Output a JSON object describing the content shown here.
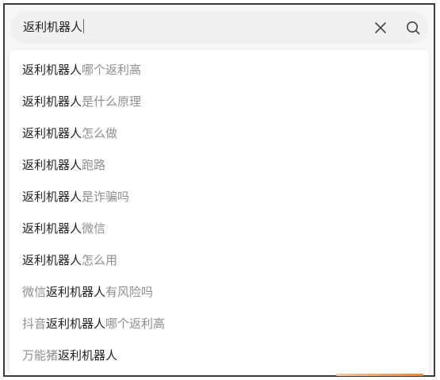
{
  "search": {
    "query": "返利机器人"
  },
  "icons": {
    "clear": "close-icon",
    "search": "search-icon"
  },
  "colors": {
    "highlight_text": "#222222",
    "secondary_text": "#8e8e8e",
    "caret": "#e8325a"
  },
  "suggestions": [
    {
      "prefix": "",
      "match": "返利机器人",
      "suffix": "哪个返利高"
    },
    {
      "prefix": "",
      "match": "返利机器人",
      "suffix": "是什么原理"
    },
    {
      "prefix": "",
      "match": "返利机器人",
      "suffix": "怎么做"
    },
    {
      "prefix": "",
      "match": "返利机器人",
      "suffix": "跑路"
    },
    {
      "prefix": "",
      "match": "返利机器人",
      "suffix": "是诈骗吗"
    },
    {
      "prefix": "",
      "match": "返利机器人",
      "suffix": "微信"
    },
    {
      "prefix": "",
      "match": "返利机器人",
      "suffix": "怎么用"
    },
    {
      "prefix": "微信",
      "match": "返利机器人",
      "suffix": "有风险吗"
    },
    {
      "prefix": "抖音",
      "match": "返利机器人",
      "suffix": "哪个返利高"
    },
    {
      "prefix": "万能猪",
      "match": "返利机器人",
      "suffix": ""
    }
  ]
}
